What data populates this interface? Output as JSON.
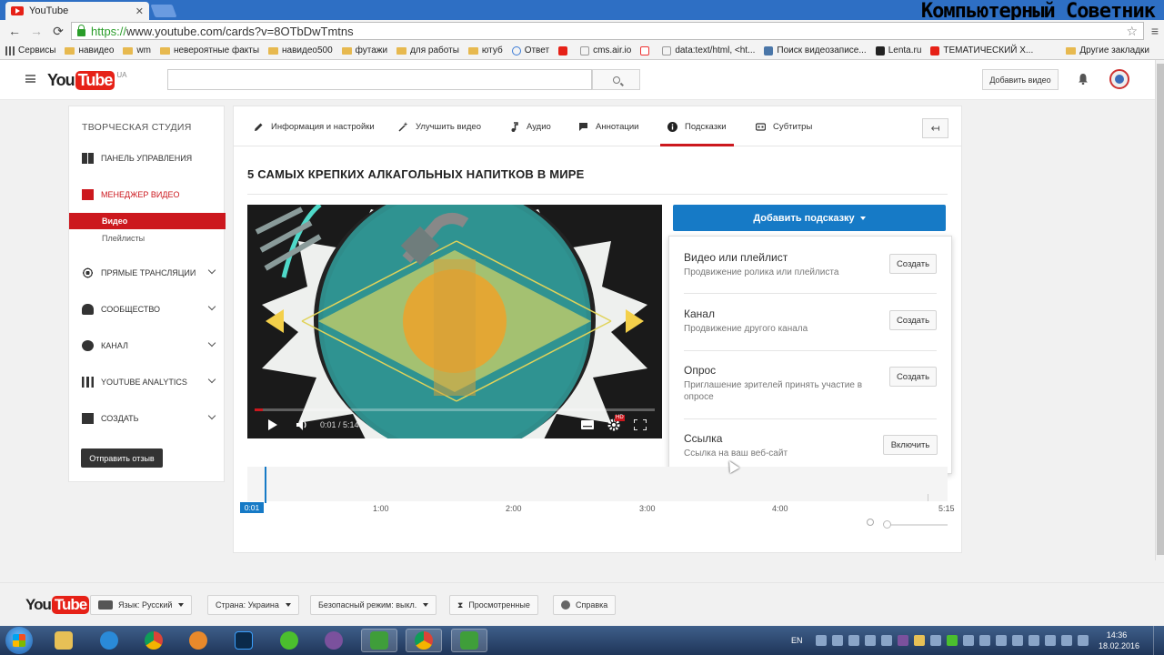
{
  "browser": {
    "tab_title": "YouTube",
    "tab_close": "✕",
    "url_https": "https://",
    "url_rest": "www.youtube.com/cards?v=8OTbDwTmtns",
    "watermark": "Компьютерный Советник",
    "bookmarks": [
      {
        "label": "Сервисы",
        "icon": "apps-icon"
      },
      {
        "label": "навидео",
        "icon": "folder-icon"
      },
      {
        "label": "wm",
        "icon": "folder-icon"
      },
      {
        "label": "невероятные факты",
        "icon": "folder-icon"
      },
      {
        "label": "навидео500",
        "icon": "folder-icon"
      },
      {
        "label": "футажи",
        "icon": "folder-icon"
      },
      {
        "label": "для работы",
        "icon": "folder-icon"
      },
      {
        "label": "ютуб",
        "icon": "folder-icon"
      },
      {
        "label": "Ответ",
        "icon": "question-icon"
      },
      {
        "label": "",
        "icon": "youtube-icon"
      },
      {
        "label": "cms.air.io",
        "icon": "page-icon"
      },
      {
        "label": "",
        "icon": "yandex-icon"
      },
      {
        "label": "data:text/html, <ht...",
        "icon": "page-icon"
      },
      {
        "label": "Поиск видеозаписе...",
        "icon": "vk-icon"
      },
      {
        "label": "Lenta.ru",
        "icon": "lenta-icon"
      },
      {
        "label": "ТЕМАТИЧЕСКИЙ Х...",
        "icon": "youtube-icon"
      }
    ],
    "other_bookmarks": "Другие закладки"
  },
  "header": {
    "logo_you": "You",
    "logo_tube": "Tube",
    "logo_region": "UA",
    "search_placeholder": "",
    "upload_label": "Добавить видео"
  },
  "sidebar": {
    "title": "ТВОРЧЕСКАЯ СТУДИЯ",
    "items": [
      {
        "label": "ПАНЕЛЬ УПРАВЛЕНИЯ"
      },
      {
        "label": "МЕНЕДЖЕР ВИДЕО"
      },
      {
        "label": "ПРЯМЫЕ ТРАНСЛЯЦИИ"
      },
      {
        "label": "СООБЩЕСТВО"
      },
      {
        "label": "КАНАЛ"
      },
      {
        "label": "YOUTUBE ANALYTICS"
      },
      {
        "label": "СОЗДАТЬ"
      }
    ],
    "sub_items": [
      {
        "label": "Видео"
      },
      {
        "label": "Плейлисты"
      }
    ],
    "feedback_label": "Отправить отзыв"
  },
  "editor": {
    "tabs": [
      {
        "label": "Информация и настройки"
      },
      {
        "label": "Улучшить видео"
      },
      {
        "label": "Аудио"
      },
      {
        "label": "Аннотации"
      },
      {
        "label": "Подсказки"
      },
      {
        "label": "Субтитры"
      }
    ],
    "back_label": "↤",
    "video_title": "5 САМЫХ КРЕПКИХ АЛКАГОЛЬНЫХ НАПИТКОВ В МИРЕ",
    "player": {
      "time": "0:01 / 5:14",
      "hd_badge": "HD",
      "progress": 0.003
    },
    "add_card_label": "Добавить подсказку",
    "card_types": [
      {
        "title": "Видео или плейлист",
        "desc": "Продвижение ролика или плейлиста",
        "button": "Создать"
      },
      {
        "title": "Канал",
        "desc": "Продвижение другого канала",
        "button": "Создать"
      },
      {
        "title": "Опрос",
        "desc": "Приглашение зрителей принять участие в опросе",
        "button": "Создать"
      },
      {
        "title": "Ссылка",
        "desc": "Ссылка на ваш веб-сайт",
        "button": "Включить"
      }
    ],
    "timeline": {
      "current": "0:01",
      "labels": [
        "1:00",
        "2:00",
        "3:00",
        "4:00",
        "5:15"
      ]
    }
  },
  "footer": {
    "logo_you": "You",
    "logo_tube": "Tube",
    "language": "Язык: Русский",
    "country": "Страна: Украина",
    "safety": "Безопасный режим: выкл.",
    "history": "Просмотренные",
    "help": "Справка"
  },
  "taskbar": {
    "lang": "EN",
    "time": "14:36",
    "date": "18.02.2016"
  },
  "colors": {
    "youtube_red": "#cc181e",
    "youtube_blue": "#167ac6",
    "chrome_blue": "#2e6fc4"
  }
}
